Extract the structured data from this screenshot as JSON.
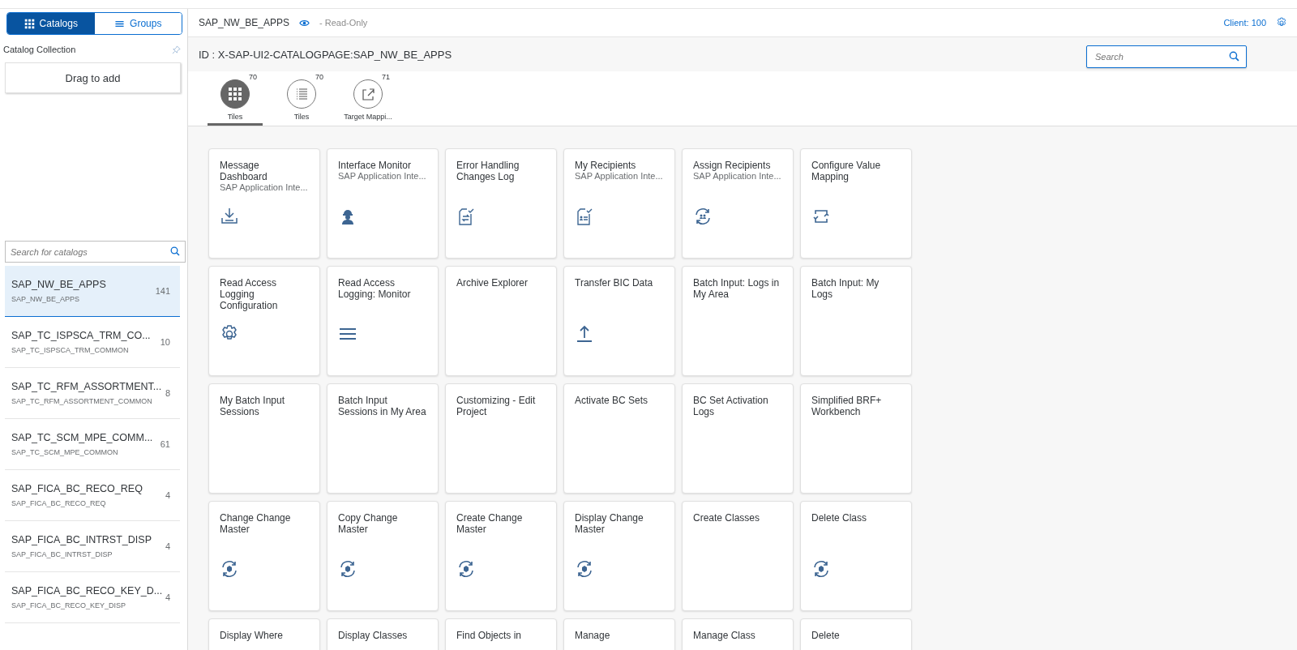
{
  "sidebar": {
    "segments": [
      {
        "label": "Catalogs",
        "kind": "grid",
        "selected": true
      },
      {
        "label": "Groups",
        "kind": "lines",
        "selected": false
      }
    ],
    "collection_title": "Catalog Collection",
    "drop_zone": "Drag to add",
    "search": {
      "placeholder": "Search for catalogs"
    },
    "catalogs": [
      {
        "name": "SAP_NW_BE_APPS",
        "id": "SAP_NW_BE_APPS",
        "count": "141",
        "selected": true
      },
      {
        "name": "SAP_TC_ISPSCA_TRM_CO...",
        "id": "SAP_TC_ISPSCA_TRM_COMMON",
        "count": "10",
        "selected": false
      },
      {
        "name": "SAP_TC_RFM_ASSORTMENT...",
        "id": "SAP_TC_RFM_ASSORTMENT_COMMON",
        "count": "8",
        "selected": false
      },
      {
        "name": "SAP_TC_SCM_MPE_COMM...",
        "id": "SAP_TC_SCM_MPE_COMMON",
        "count": "61",
        "selected": false
      },
      {
        "name": "SAP_FICA_BC_RECO_REQ",
        "id": "SAP_FICA_BC_RECO_REQ",
        "count": "4",
        "selected": false
      },
      {
        "name": "SAP_FICA_BC_INTRST_DISP",
        "id": "SAP_FICA_BC_INTRST_DISP",
        "count": "4",
        "selected": false
      },
      {
        "name": "SAP_FICA_BC_RECO_KEY_D...",
        "id": "SAP_FICA_BC_RECO_KEY_DISP",
        "count": "4",
        "selected": false
      }
    ]
  },
  "header": {
    "title": "SAP_NW_BE_APPS",
    "mode": "- Read-Only",
    "client": "Client: 100"
  },
  "page": {
    "id_label": "ID : X-SAP-UI2-CATALOGPAGE:SAP_NW_BE_APPS",
    "search": {
      "placeholder": "Search"
    }
  },
  "tabs": [
    {
      "label": "Tiles",
      "count": "70",
      "kind": "grid",
      "selected": true
    },
    {
      "label": "Tiles",
      "count": "70",
      "kind": "list",
      "selected": false
    },
    {
      "label": "Target Mappi...",
      "count": "71",
      "kind": "share",
      "selected": false
    }
  ],
  "tiles": [
    {
      "title": "Message Dashboard",
      "subtitle": "SAP Application Inte...",
      "kind": "download"
    },
    {
      "title": "Interface Monitor",
      "subtitle": "SAP Application Inte...",
      "kind": "worker"
    },
    {
      "title": "Error Handling Changes Log",
      "kind": "doc-transfer"
    },
    {
      "title": "My Recipients",
      "subtitle": "SAP Application Inte...",
      "kind": "doc-person"
    },
    {
      "title": "Assign Recipients",
      "subtitle": "SAP Application Inte...",
      "kind": "sync-people"
    },
    {
      "title": "Configure Value Mapping",
      "kind": "swap-frame"
    },
    {
      "title": "Read Access Logging Configuration",
      "kind": "gear"
    },
    {
      "title": "Read Access Logging: Monitor",
      "kind": "lines"
    },
    {
      "title": "Archive Explorer",
      "kind": "plain"
    },
    {
      "title": "Transfer BIC Data",
      "kind": "upload"
    },
    {
      "title": "Batch Input: Logs in My Area",
      "kind": "plain"
    },
    {
      "title": "Batch Input: My Logs",
      "kind": "plain"
    },
    {
      "title": "My Batch Input Sessions",
      "kind": "plain"
    },
    {
      "title": "Batch Input Sessions in My Area",
      "kind": "plain"
    },
    {
      "title": "Customizing - Edit Project",
      "kind": "plain"
    },
    {
      "title": "Activate BC Sets",
      "kind": "plain"
    },
    {
      "title": "BC Set Activation Logs",
      "kind": "plain"
    },
    {
      "title": "Simplified BRF+ Workbench",
      "kind": "plain"
    },
    {
      "title": "Change Change Master",
      "kind": "sync-cube"
    },
    {
      "title": "Copy Change Master",
      "kind": "sync-cube"
    },
    {
      "title": "Create Change Master",
      "kind": "sync-cube"
    },
    {
      "title": "Display Change Master",
      "kind": "sync-cube"
    },
    {
      "title": "Create Classes",
      "kind": "plain"
    },
    {
      "title": "Delete Class",
      "kind": "sync-cube"
    },
    {
      "title": "Display Where",
      "kind": "plain"
    },
    {
      "title": "Display Classes",
      "kind": "plain"
    },
    {
      "title": "Find Objects in",
      "kind": "plain"
    },
    {
      "title": "Manage",
      "kind": "plain"
    },
    {
      "title": "Manage Class",
      "kind": "plain"
    },
    {
      "title": "Delete",
      "kind": "plain"
    }
  ]
}
